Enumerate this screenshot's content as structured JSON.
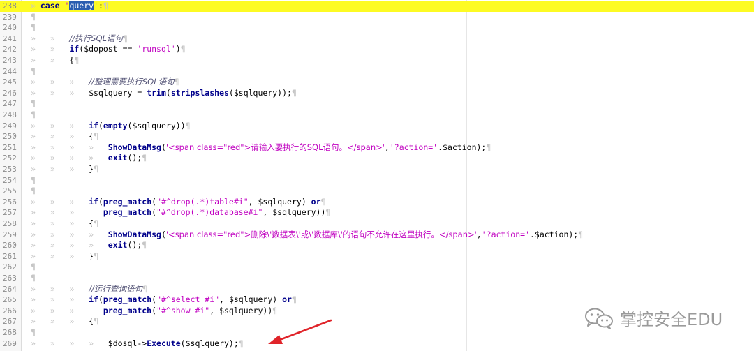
{
  "lines": [
    {
      "n": "238",
      "tokens": [
        [
          "ws",
          "» "
        ],
        [
          "kw",
          "case"
        ],
        [
          "op",
          " "
        ],
        [
          "str",
          "'"
        ],
        [
          "sel",
          "query"
        ],
        [
          "str",
          "'"
        ],
        [
          "op",
          ":"
        ],
        [
          "ws",
          "¶"
        ]
      ]
    },
    {
      "n": "239",
      "tokens": [
        [
          "ws",
          "¶"
        ]
      ]
    },
    {
      "n": "240",
      "tokens": [
        [
          "ws",
          "¶"
        ]
      ]
    },
    {
      "n": "241",
      "tokens": [
        [
          "ws",
          "»   »   "
        ],
        [
          "cmt",
          "//执行SQL语句"
        ],
        [
          "ws",
          "¶"
        ]
      ]
    },
    {
      "n": "242",
      "tokens": [
        [
          "ws",
          "»   »   "
        ],
        [
          "kw",
          "if"
        ],
        [
          "op",
          "("
        ],
        [
          "var",
          "$dopost"
        ],
        [
          "op",
          " == "
        ],
        [
          "str",
          "'runsql'"
        ],
        [
          "op",
          ")"
        ],
        [
          "ws",
          "¶"
        ]
      ]
    },
    {
      "n": "243",
      "tokens": [
        [
          "ws",
          "»   »   "
        ],
        [
          "op",
          "{"
        ],
        [
          "ws",
          "¶"
        ]
      ]
    },
    {
      "n": "244",
      "tokens": [
        [
          "ws",
          "¶"
        ]
      ]
    },
    {
      "n": "245",
      "tokens": [
        [
          "ws",
          "»   »   »   "
        ],
        [
          "cmt",
          "//整理需要执行SQL语句"
        ],
        [
          "ws",
          "¶"
        ]
      ]
    },
    {
      "n": "246",
      "tokens": [
        [
          "ws",
          "»   »   »   "
        ],
        [
          "var",
          "$sqlquery"
        ],
        [
          "op",
          " = "
        ],
        [
          "fn",
          "trim"
        ],
        [
          "op",
          "("
        ],
        [
          "fn",
          "stripslashes"
        ],
        [
          "op",
          "("
        ],
        [
          "var",
          "$sqlquery"
        ],
        [
          "op",
          "));"
        ],
        [
          "ws",
          "¶"
        ]
      ]
    },
    {
      "n": "247",
      "tokens": [
        [
          "ws",
          "¶"
        ]
      ]
    },
    {
      "n": "248",
      "tokens": [
        [
          "ws",
          "¶"
        ]
      ]
    },
    {
      "n": "249",
      "tokens": [
        [
          "ws",
          "»   »   »   "
        ],
        [
          "kw",
          "if"
        ],
        [
          "op",
          "("
        ],
        [
          "fn",
          "empty"
        ],
        [
          "op",
          "("
        ],
        [
          "var",
          "$sqlquery"
        ],
        [
          "op",
          "))"
        ],
        [
          "ws",
          "¶"
        ]
      ]
    },
    {
      "n": "250",
      "tokens": [
        [
          "ws",
          "»   »   »   "
        ],
        [
          "op",
          "{"
        ],
        [
          "ws",
          "¶"
        ]
      ]
    },
    {
      "n": "251",
      "tokens": [
        [
          "ws",
          "»   »   »   »   "
        ],
        [
          "fn",
          "ShowDataMsg"
        ],
        [
          "op",
          "("
        ],
        [
          "str",
          "'<span class=\"red\">请输入要执行的SQL语句。</span>'"
        ],
        [
          "op",
          ","
        ],
        [
          "str",
          "'?action='"
        ],
        [
          "op",
          ".$action);"
        ],
        [
          "ws",
          "¶"
        ]
      ]
    },
    {
      "n": "252",
      "tokens": [
        [
          "ws",
          "»   »   »   »   "
        ],
        [
          "fn",
          "exit"
        ],
        [
          "op",
          "();"
        ],
        [
          "ws",
          "¶"
        ]
      ]
    },
    {
      "n": "253",
      "tokens": [
        [
          "ws",
          "»   »   »   "
        ],
        [
          "op",
          "}"
        ],
        [
          "ws",
          "¶"
        ]
      ]
    },
    {
      "n": "254",
      "tokens": [
        [
          "ws",
          "¶"
        ]
      ]
    },
    {
      "n": "255",
      "tokens": [
        [
          "ws",
          "¶"
        ]
      ]
    },
    {
      "n": "256",
      "tokens": [
        [
          "ws",
          "»   »   »   "
        ],
        [
          "kw",
          "if"
        ],
        [
          "op",
          "("
        ],
        [
          "fn",
          "preg_match"
        ],
        [
          "op",
          "("
        ],
        [
          "str",
          "\"#^drop(.*)table#i\""
        ],
        [
          "op",
          ", "
        ],
        [
          "var",
          "$sqlquery"
        ],
        [
          "op",
          ") "
        ],
        [
          "kw",
          "or"
        ],
        [
          "ws",
          "¶"
        ]
      ]
    },
    {
      "n": "257",
      "tokens": [
        [
          "ws",
          "»   »   »      "
        ],
        [
          "fn",
          "preg_match"
        ],
        [
          "op",
          "("
        ],
        [
          "str",
          "\"#^drop(.*)database#i\""
        ],
        [
          "op",
          ", "
        ],
        [
          "var",
          "$sqlquery"
        ],
        [
          "op",
          "))"
        ],
        [
          "ws",
          "¶"
        ]
      ]
    },
    {
      "n": "258",
      "tokens": [
        [
          "ws",
          "»   »   »   "
        ],
        [
          "op",
          "{"
        ],
        [
          "ws",
          "¶"
        ]
      ]
    },
    {
      "n": "259",
      "tokens": [
        [
          "ws",
          "»   »   »   »   "
        ],
        [
          "fn",
          "ShowDataMsg"
        ],
        [
          "op",
          "("
        ],
        [
          "str",
          "'<span class=\"red\">删除\\'数据表\\'或\\'数据库\\'的语句不允许在这里执行。</span>'"
        ],
        [
          "op",
          ","
        ],
        [
          "str",
          "'?action='"
        ],
        [
          "op",
          ".$action);"
        ],
        [
          "ws",
          "¶"
        ]
      ]
    },
    {
      "n": "260",
      "tokens": [
        [
          "ws",
          "»   »   »   »   "
        ],
        [
          "fn",
          "exit"
        ],
        [
          "op",
          "();"
        ],
        [
          "ws",
          "¶"
        ]
      ]
    },
    {
      "n": "261",
      "tokens": [
        [
          "ws",
          "»   »   »   "
        ],
        [
          "op",
          "}"
        ],
        [
          "ws",
          "¶"
        ]
      ]
    },
    {
      "n": "262",
      "tokens": [
        [
          "ws",
          "¶"
        ]
      ]
    },
    {
      "n": "263",
      "tokens": [
        [
          "ws",
          "¶"
        ]
      ]
    },
    {
      "n": "264",
      "tokens": [
        [
          "ws",
          "»   »   »   "
        ],
        [
          "cmt",
          "//运行查询语句"
        ],
        [
          "ws",
          "¶"
        ]
      ]
    },
    {
      "n": "265",
      "tokens": [
        [
          "ws",
          "»   »   »   "
        ],
        [
          "kw",
          "if"
        ],
        [
          "op",
          "("
        ],
        [
          "fn",
          "preg_match"
        ],
        [
          "op",
          "("
        ],
        [
          "str",
          "\"#^select #i\""
        ],
        [
          "op",
          ", "
        ],
        [
          "var",
          "$sqlquery"
        ],
        [
          "op",
          ") "
        ],
        [
          "kw",
          "or"
        ],
        [
          "ws",
          "¶"
        ]
      ]
    },
    {
      "n": "266",
      "tokens": [
        [
          "ws",
          "»   »   »      "
        ],
        [
          "fn",
          "preg_match"
        ],
        [
          "op",
          "("
        ],
        [
          "str",
          "\"#^show #i\""
        ],
        [
          "op",
          ", "
        ],
        [
          "var",
          "$sqlquery"
        ],
        [
          "op",
          "))"
        ],
        [
          "ws",
          "¶"
        ]
      ]
    },
    {
      "n": "267",
      "tokens": [
        [
          "ws",
          "»   »   »   "
        ],
        [
          "op",
          "{"
        ],
        [
          "ws",
          "¶"
        ]
      ]
    },
    {
      "n": "268",
      "tokens": [
        [
          "ws",
          "¶"
        ]
      ]
    },
    {
      "n": "269",
      "tokens": [
        [
          "ws",
          "»   »   »   »   "
        ],
        [
          "var",
          "$dosql"
        ],
        [
          "op",
          "->"
        ],
        [
          "fn",
          "Execute"
        ],
        [
          "op",
          "("
        ],
        [
          "var",
          "$sqlquery"
        ],
        [
          "op",
          ");"
        ],
        [
          "ws",
          "¶"
        ]
      ]
    }
  ],
  "watermark": {
    "text": "掌控安全EDU"
  },
  "colors": {
    "current_line": "#fdfb24",
    "selection": "#2a5db0",
    "arrow": "#e0242a",
    "string": "#c000c0",
    "keyword": "#00008b"
  },
  "icons": {
    "watermark_logo": "wechat-icon",
    "arrow": "red-arrow-icon"
  }
}
